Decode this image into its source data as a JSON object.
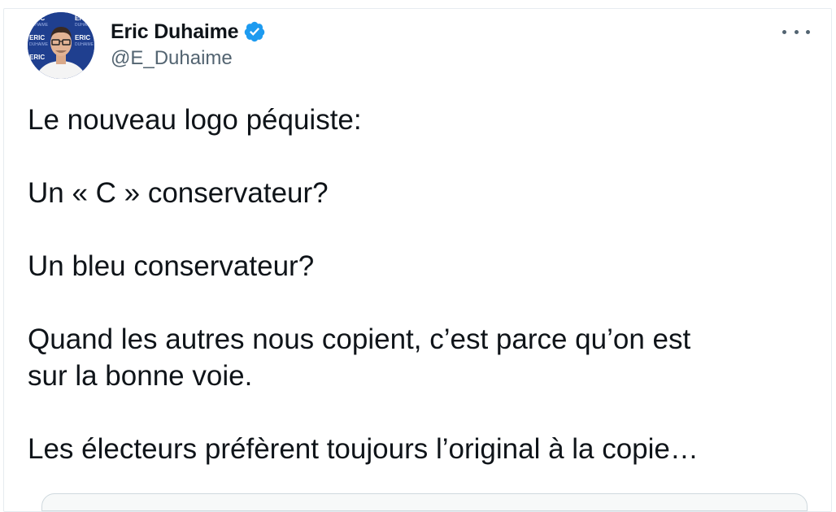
{
  "author": {
    "name": "Eric Duhaime",
    "handle": "@E_Duhaime",
    "verified": true,
    "verified_color": "#1d9bf0",
    "avatar_text": "ERIC DUHAIME",
    "avatar_backdrop_color": "#1f3f8f"
  },
  "more_icon": "more-horizontal-icon",
  "tweet": {
    "lines": [
      "Le nouveau logo péquiste:",
      "Un « C » conservateur?",
      "Un bleu conservateur?",
      "Quand les autres nous copient, c’est parce qu’on est",
      "sur la bonne voie.",
      "Les électeurs préfèrent toujours l’original à la copie…"
    ]
  },
  "colors": {
    "text_primary": "#0f1419",
    "text_secondary": "#536471",
    "border": "#e6ecf0"
  }
}
